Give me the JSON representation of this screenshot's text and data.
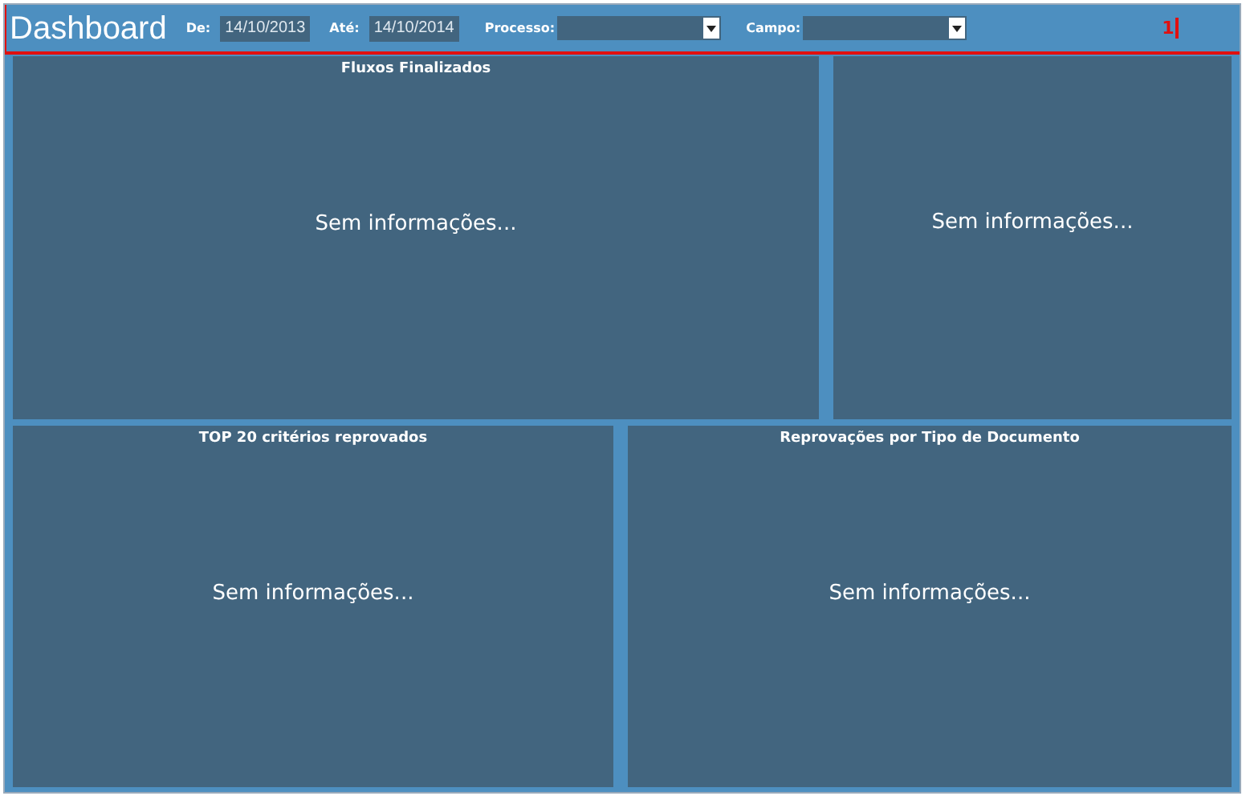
{
  "header": {
    "title": "Dashboard",
    "filters": [
      {
        "kind": "date",
        "label": "De:",
        "value": "14/10/2013"
      },
      {
        "kind": "date",
        "label": "Até:",
        "value": "14/10/2014"
      },
      {
        "kind": "select",
        "label": "Processo:"
      },
      {
        "kind": "select",
        "label": "Campo:"
      }
    ],
    "marker": "1"
  },
  "rows": [
    [
      {
        "title": "Fluxos Finalizados",
        "message": "Sem informações..."
      },
      {
        "message": "Sem informações..."
      }
    ],
    [
      {
        "title": "TOP 20 critérios reprovados",
        "message": "Sem informações..."
      },
      {
        "title": "Reprovações por Tipo de Documento",
        "message": "Sem informações..."
      }
    ]
  ]
}
